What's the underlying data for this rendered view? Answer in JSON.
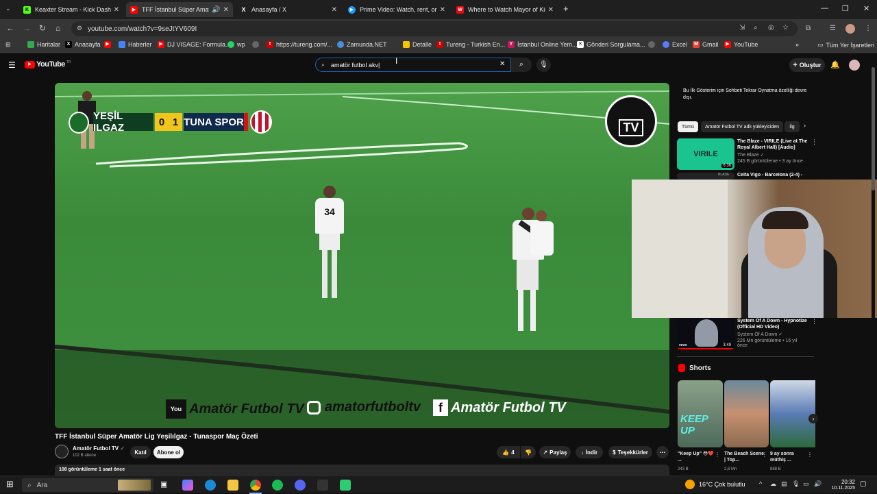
{
  "browser": {
    "tabs": [
      {
        "title": "Keaxter Stream - Kick Dashboard",
        "favicon_color": "#53fc18",
        "glyph": "K"
      },
      {
        "title": "TFF İstanbul Süper Amatör Lig",
        "favicon_color": "#ff0000",
        "glyph": "▶",
        "active": true
      },
      {
        "title": "Anasayfa / X",
        "favicon_color": "#ffffff",
        "glyph": "X"
      },
      {
        "title": "Prime Video: Watch, rent, or buy",
        "favicon_color": "#1a98ff",
        "glyph": "▶"
      },
      {
        "title": "Where to Watch Mayor of Kingstown",
        "favicon_color": "#e50914",
        "glyph": "W"
      }
    ],
    "new_tab": "+",
    "url": "youtube.com/watch?v=9seJtYV609I",
    "bookmarks": [
      {
        "label": "Haritalar",
        "color": "#34a853"
      },
      {
        "label": "Anasayfa",
        "color": "#000000"
      },
      {
        "label": "",
        "color": "#ff0000"
      },
      {
        "label": "Haberler",
        "color": "#4285f4"
      },
      {
        "label": "DJ VISAGE: Formula...",
        "color": "#ff0000"
      },
      {
        "label": "wp",
        "color": "#25d366"
      },
      {
        "label": "",
        "color": "#888888"
      },
      {
        "label": "https://tureng.com/...",
        "color": "#cc0000"
      },
      {
        "label": "Zamunda.NET",
        "color": "#4a90d9"
      },
      {
        "label": "Detalle",
        "color": "#f5c400"
      },
      {
        "label": "Tureng - Turkish En...",
        "color": "#cc0000"
      },
      {
        "label": "İstanbul Online Yem...",
        "color": "#c2185b"
      },
      {
        "label": "Gönderi Sorgulama...",
        "color": "#ffffff"
      },
      {
        "label": "",
        "color": "#888888"
      },
      {
        "label": "Excel",
        "color": "#5b7cfa"
      },
      {
        "label": "Gmail",
        "color": "#ea4335"
      },
      {
        "label": "YouTube",
        "color": "#ff0000"
      }
    ],
    "all_bookmarks": "Tüm Yer İşaretleri"
  },
  "youtube": {
    "logo": "YouTube",
    "country": "TR",
    "search_value": "amatör futbol akv|",
    "create_label": "Oluştur",
    "video": {
      "title": "TFF İstanbul Süper Amatör Lig Yeşilılgaz - Tunaspor Maç Özeti",
      "home_team": "YEŞİL ILGAZ",
      "away_team": "TUNA SPOR",
      "home_score": "0",
      "away_score": "1",
      "channel_logo_text": "TV",
      "watermarks": [
        "Amatör Futbol TV",
        "amatorfutboltv",
        "Amatör Futbol TV"
      ]
    },
    "channel": {
      "name": "Amatör Futbol TV",
      "subs": "102 B abone",
      "join": "Katıl",
      "subscribe": "Abone ol"
    },
    "actions": {
      "likes": "4",
      "share": "Paylaş",
      "download": "İndir",
      "thanks": "Teşekkürler"
    },
    "meta": "108 görüntüleme  1 saat önce",
    "chat_notice": "Bu İlk Gösterim için Sohbeti Tekrar Oynatma özelliği devre dışı.",
    "chips": [
      "Tümü",
      "Amatör Futbol TV adlı yükleyiciden",
      "İlg"
    ],
    "recommendations": [
      {
        "title": "The Blaze - VIRILE (Live at The Royal Albert Hall) [Audio]",
        "channel": "The Blaze",
        "meta": "245 B görüntüleme • 3 ay önce",
        "duration": "6:36",
        "thumb_text": "VIRILE"
      },
      {
        "title": "Celta Vigo - Barcelona (2-4) -",
        "channel": "",
        "meta": "",
        "duration": "",
        "thumb_text": "BLADE"
      },
      {
        "title": "System Of A Down - Hypnotize (Official HD Video)",
        "channel": "System Of A Down",
        "meta": "226 Mn görüntüleme • 16 yıl önce",
        "duration": "3:49",
        "thumb_text": "vevo"
      }
    ],
    "shorts_title": "Shorts",
    "shorts": [
      {
        "title": "\"Keep Up\" 😳❤️ ...",
        "views": "243 B",
        "thumb_text": "KEEP UP"
      },
      {
        "title": "The Beach Scene | Top...",
        "views": "2,8 Mn",
        "thumb_text": ""
      },
      {
        "title": "9 ay sonra müthiş ...",
        "views": "888 B",
        "thumb_text": ""
      }
    ]
  },
  "taskbar": {
    "search": "Ara",
    "weather": "16°C  Çok bulutlu",
    "time": "20:32",
    "date": "10.11.2025"
  }
}
